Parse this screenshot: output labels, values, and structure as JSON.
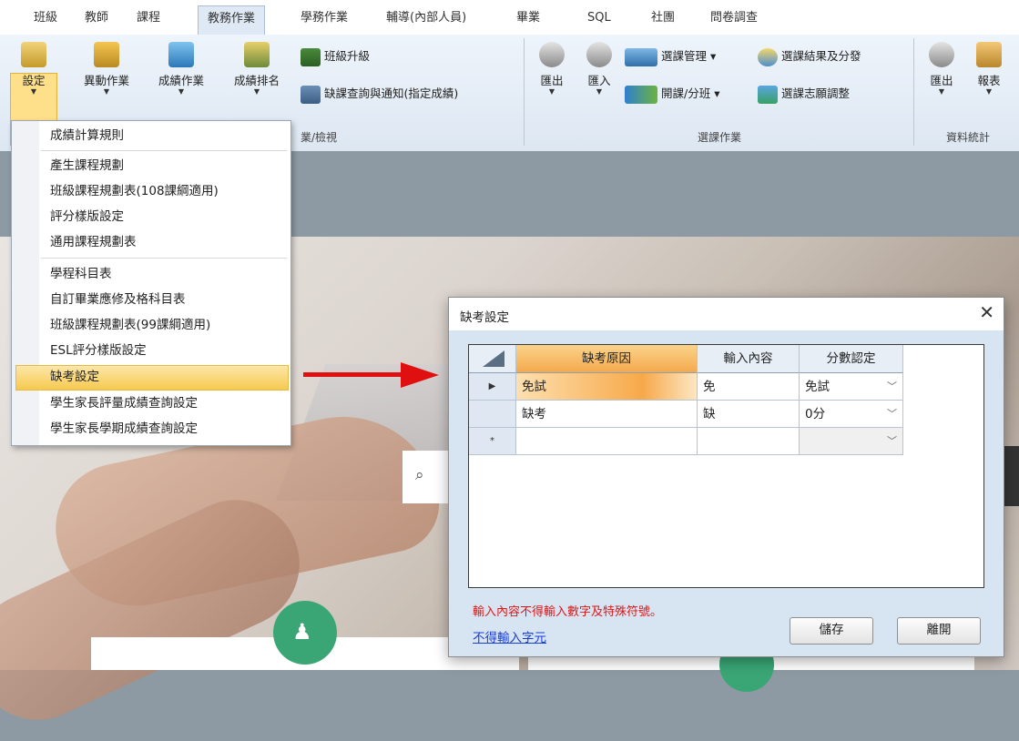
{
  "tabs": [
    "班級",
    "教師",
    "課程",
    "教務作業",
    "學務作業",
    "輔導(內部人員)",
    "畢業",
    "SQL",
    "社團",
    "問卷調查"
  ],
  "ribbon": {
    "settings_label": "設定",
    "change_label": "異動作業",
    "grade_label": "成績作業",
    "rank_label": "成績排名",
    "class_upgrade_label": "班級升級",
    "absence_query_label": "缺課查詢與通知(指定成績)",
    "group_view_label": "業/檢視",
    "export_label": "匯出",
    "import_label": "匯入",
    "course_mgmt_label": "選課管理",
    "open_class_label": "開課/分班",
    "select_result_label": "選課結果及分發",
    "wish_adjust_label": "選課志願調整",
    "course_group_label": "選課作業",
    "export2_label": "匯出",
    "report_label": "報表",
    "stats_group_label": "資料統計"
  },
  "dropdown": {
    "items": [
      "成績計算規則",
      "產生課程規劃",
      "班級課程規劃表(108課綱適用)",
      "評分樣版設定",
      "通用課程規劃表",
      "學程科目表",
      "自訂畢業應修及格科目表",
      "班級課程規劃表(99課綱適用)",
      "ESL評分樣版設定",
      "缺考設定",
      "學生家長評量成績查詢設定",
      "學生家長學期成績查詢設定"
    ],
    "highlighted": "缺考設定"
  },
  "dialog": {
    "title": "缺考設定",
    "close": "✕",
    "columns": [
      "缺考原因",
      "輸入內容",
      "分數認定"
    ],
    "rows": [
      {
        "marker": "▶",
        "reason": "免試",
        "input": "免",
        "score": "免試"
      },
      {
        "marker": "",
        "reason": "缺考",
        "input": "缺",
        "score": "0分"
      },
      {
        "marker": "*",
        "reason": "",
        "input": "",
        "score": ""
      }
    ],
    "error_text": "輸入內容不得輸入數字及特殊符號。",
    "link_text": "不得輸入字元",
    "save_label": "儲存",
    "leave_label": "離開"
  },
  "colors": {
    "highlight": "#f6c94f",
    "arrow": "#e01010",
    "error": "#e01616",
    "link": "#1a3fd6"
  }
}
